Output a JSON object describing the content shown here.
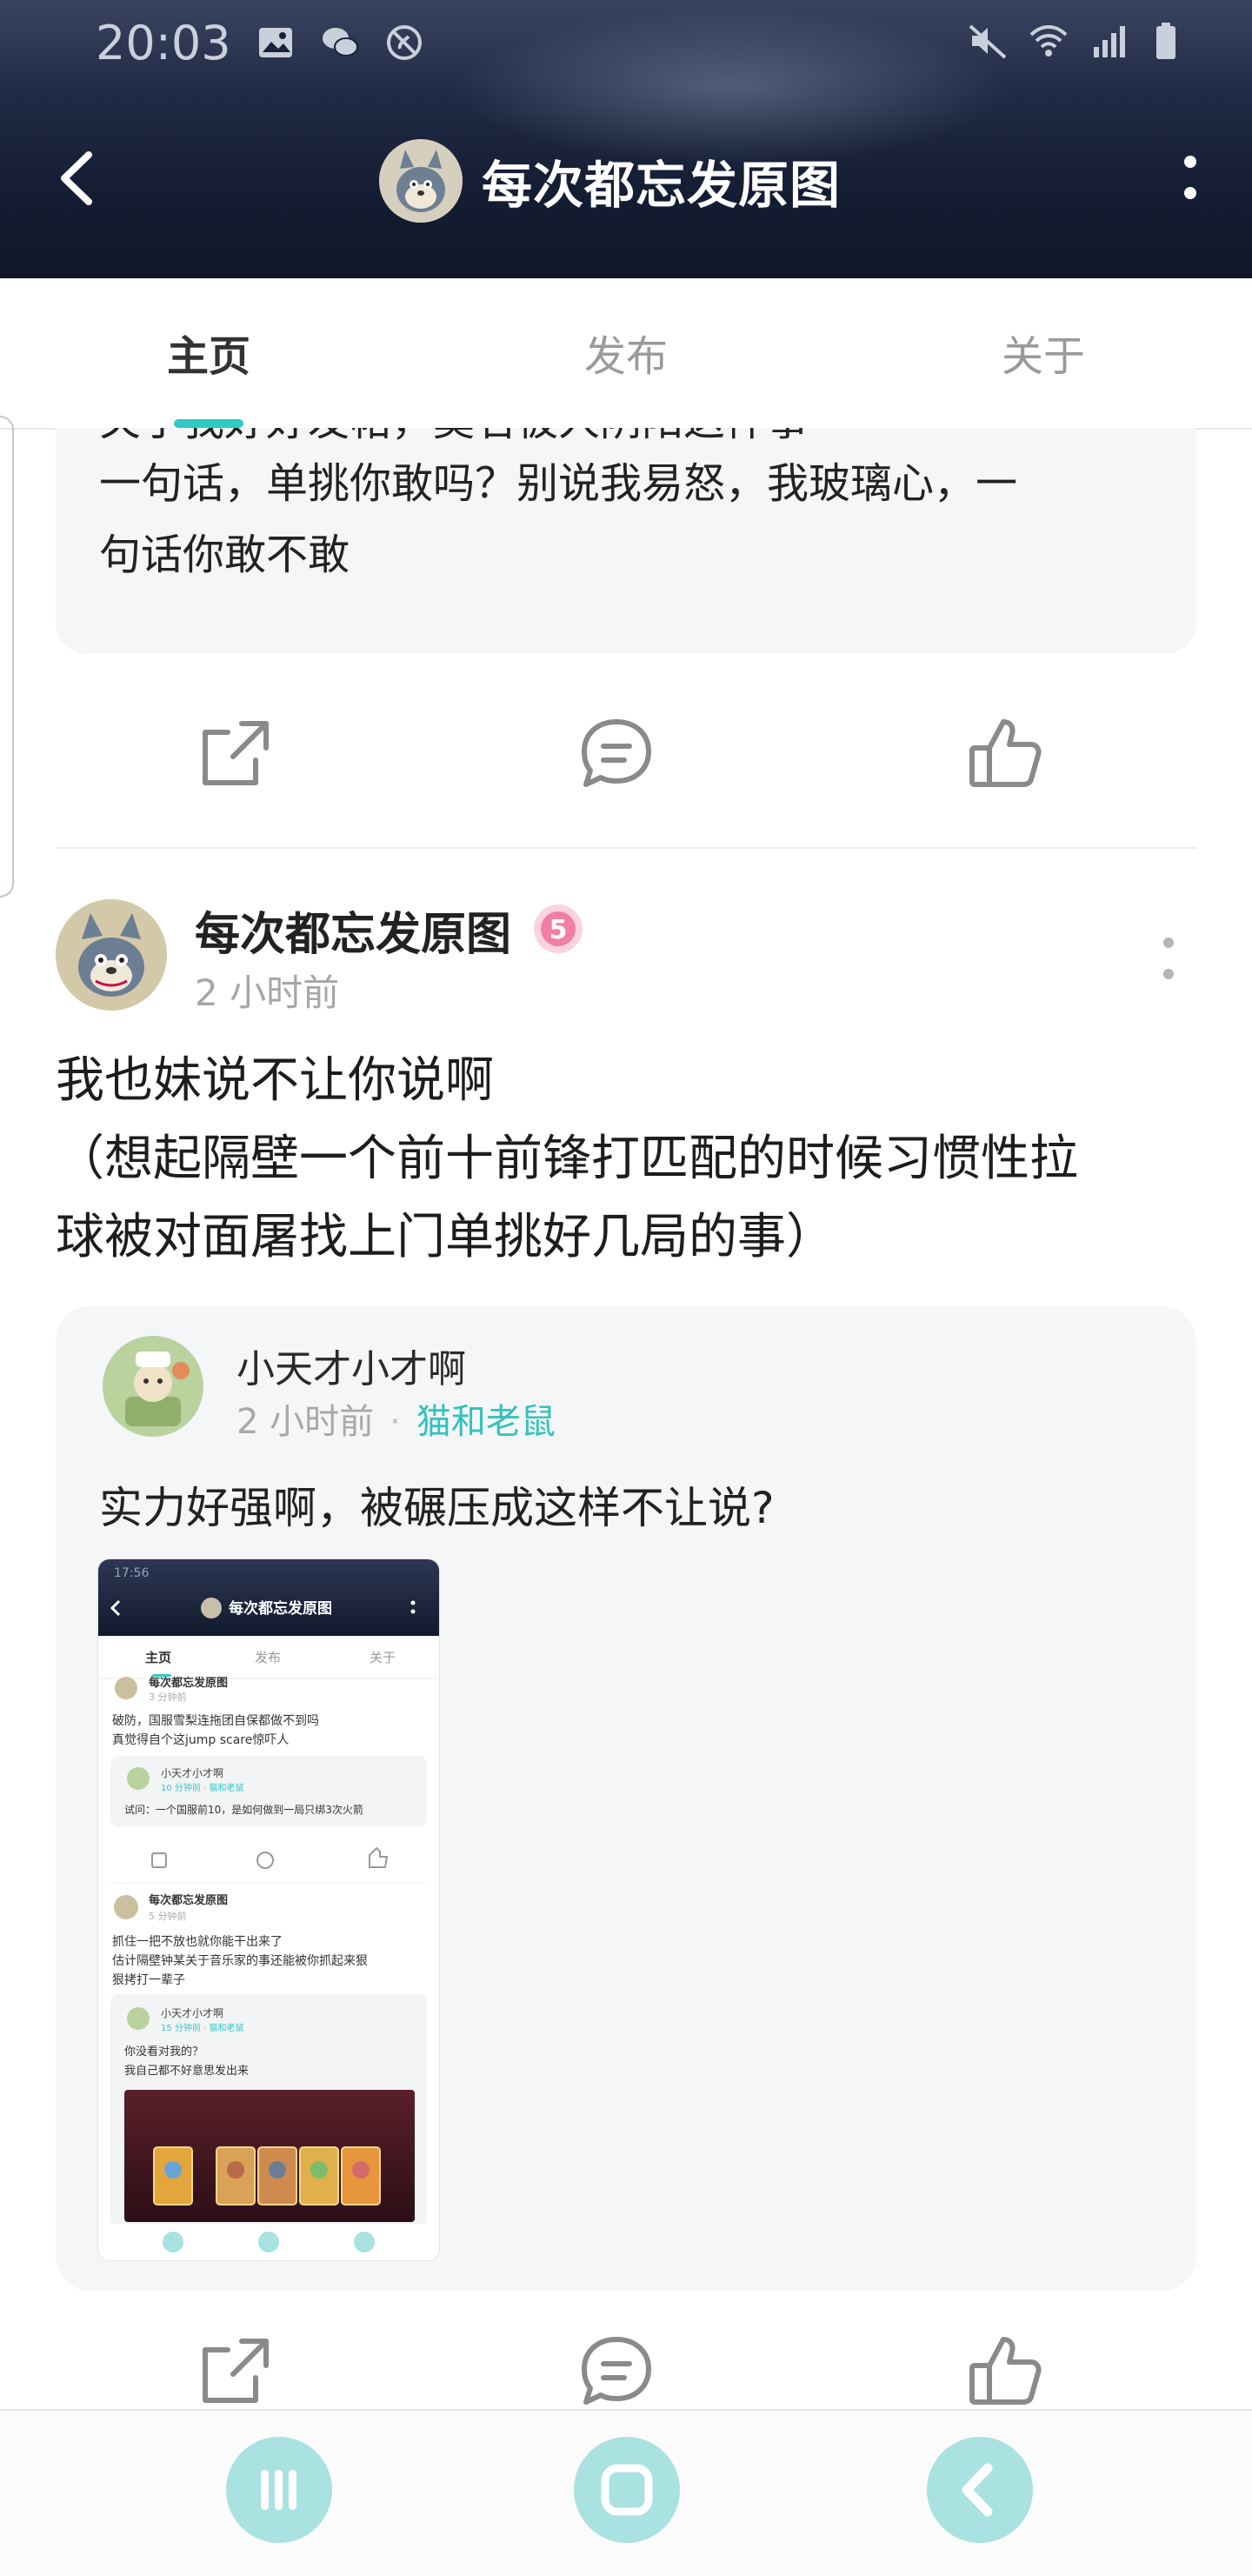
{
  "status_bar": {
    "time": "20:03"
  },
  "header": {
    "title": "每次都忘发原图"
  },
  "tabs": [
    {
      "label": "主页"
    },
    {
      "label": "发布"
    },
    {
      "label": "关于"
    }
  ],
  "previous_post": {
    "quote_lines": [
      "关于我好好发帖，莫名被人阴阳这件事",
      "一句话，单挑你敢吗？别说我易怒，我玻璃心，一",
      "句话你敢不敢"
    ]
  },
  "post": {
    "author": "每次都忘发原图",
    "level_badge": "5",
    "time": "2 小时前",
    "text_lines": [
      "我也妹说不让你说啊",
      "（想起隔壁一个前十前锋打匹配的时候习惯性拉",
      "球被对面屠找上门单挑好几局的事）"
    ],
    "quoted": {
      "author": "小天才小才啊",
      "time": "2 小时前",
      "topic": "猫和老鼠",
      "text": "实力好强啊，被碾压成这样不让说?"
    }
  },
  "thumbnail": {
    "status_time": "17:56",
    "title": "每次都忘发原图",
    "tabs": [
      "主页",
      "发布",
      "关于"
    ],
    "top_author": "每次都忘发原图",
    "top_time": "3 分钟前",
    "top_text_lines": [
      "破防，国服雪梨连拖团自保都做不到吗",
      "真觉得自个这jump scare惊吓人"
    ],
    "top_quote_author": "小天才小才啊",
    "top_quote_meta": "10 分钟前 · 猫和老鼠",
    "top_quote_text": "试问：一个国服前10，是如何做到一局只绑3次火箭",
    "mid_author": "每次都忘发原图",
    "mid_time": "5 分钟前",
    "mid_text_lines": [
      "抓住一把不放也就你能干出来了",
      "估计隔壁钟某关于音乐家的事还能被你抓起来狠",
      "狠拷打一辈子"
    ],
    "mid_quote_author": "小天才小才啊",
    "mid_quote_meta": "15 分钟前 · 猫和老鼠",
    "mid_quote_lines": [
      "你没看对我的？",
      "我自己都不好意思发出来"
    ]
  },
  "colors": {
    "accent": "#31c9c4",
    "header_bg": "#1a2239",
    "card_bg": "#f5f6f8",
    "nav_button": "#a9e2e0"
  }
}
